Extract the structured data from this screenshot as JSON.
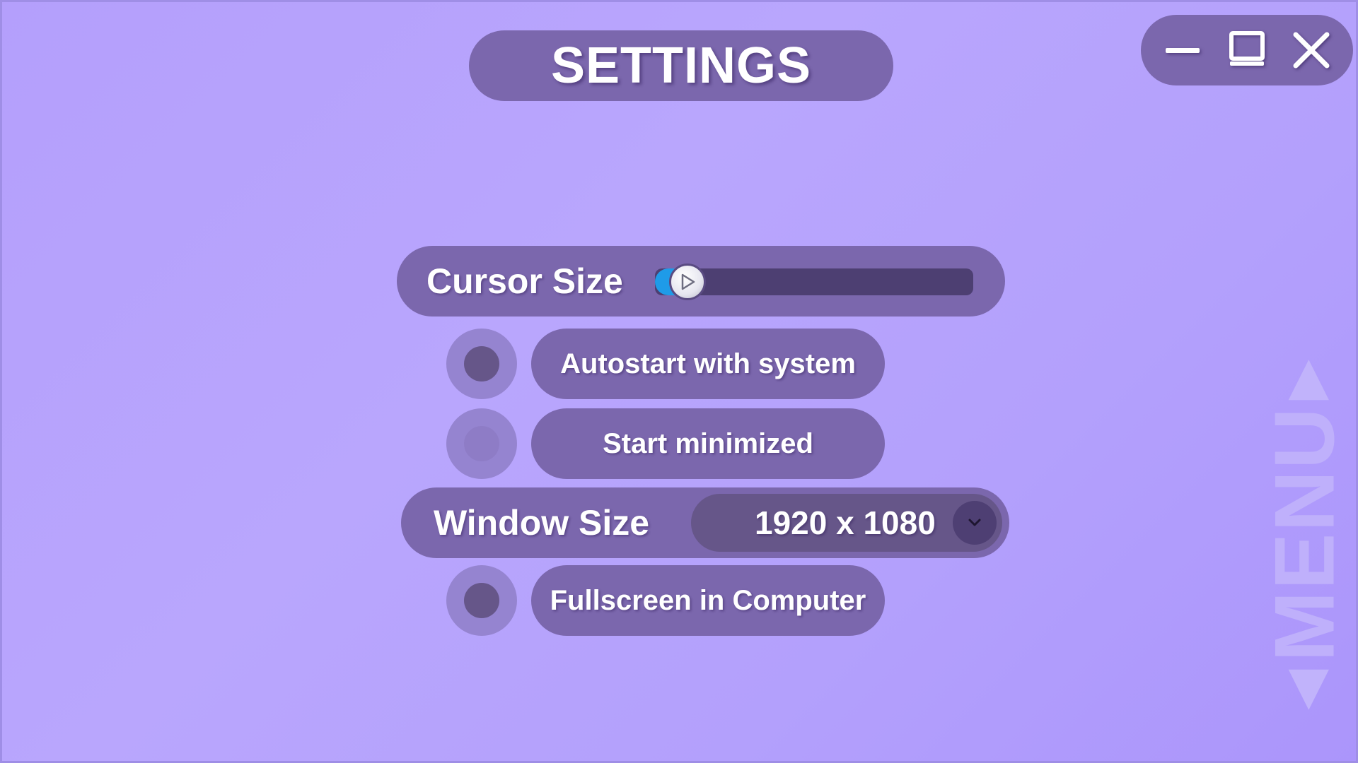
{
  "header": {
    "title": "SETTINGS"
  },
  "window_controls": {
    "minimize_icon": "minimize-icon",
    "maximize_icon": "maximize-icon",
    "close_icon": "close-icon"
  },
  "cursor_size": {
    "label": "Cursor Size",
    "level": 0.05,
    "knob_icon": "play-icon"
  },
  "options": [
    {
      "label": "Autostart with system",
      "checked": true
    },
    {
      "label": "Start minimized",
      "checked": false
    },
    {
      "label": "Fullscreen in Computer",
      "checked": true
    }
  ],
  "window_size": {
    "label": "Window Size",
    "value": "1920 x 1080",
    "icon": "chevron-down-icon"
  },
  "side_menu": {
    "label": "MENU",
    "icon_left": "triangle-left-icon",
    "icon_right": "triangle-right-icon"
  },
  "colors": {
    "background": "#b49ffc",
    "pill": "#7b67ad",
    "accent": "#1f9be8",
    "track": "#4d3f72"
  }
}
